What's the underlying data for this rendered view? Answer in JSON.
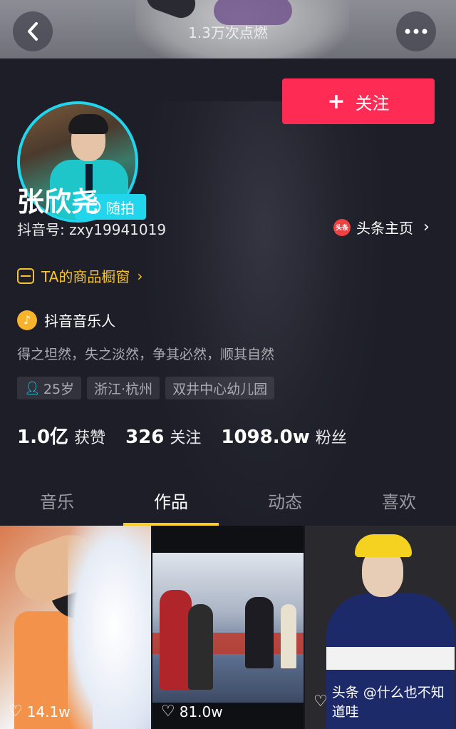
{
  "header": {
    "heat_text": "1.3万次点燃",
    "back_icon": "back-arrow-icon",
    "more_icon": "more-dots-icon"
  },
  "profile": {
    "avatar_badge": "随拍",
    "follow_button": "关注",
    "name": "张欣尧",
    "douyin_id": "抖音号: zxy19941019",
    "toutiao_logo": "头条",
    "toutiao_link": "头条主页",
    "shop_link": "TA的商品橱窗",
    "music_badge": "抖音音乐人",
    "bio": "得之坦然，失之淡然，争其必然，顺其自然",
    "tags": [
      "25岁",
      "浙江·杭州",
      "双井中心幼儿园"
    ],
    "stats": [
      {
        "num": "1.0亿",
        "label": "获赞"
      },
      {
        "num": "326",
        "label": "关注"
      },
      {
        "num": "1098.0w",
        "label": "粉丝"
      }
    ]
  },
  "tabs": [
    "音乐",
    "作品",
    "动态",
    "喜欢"
  ],
  "active_tab": "作品",
  "videos": [
    {
      "likes": "14.1w"
    },
    {
      "likes": "81.0w"
    },
    {
      "likes": "",
      "watermark": "头条 @什么也不知道哇"
    }
  ],
  "colors": {
    "accent_red": "#fe2c55",
    "accent_cyan": "#20d5ec",
    "tab_underline": "#facd2b",
    "shop_yellow": "#f7c32e"
  }
}
